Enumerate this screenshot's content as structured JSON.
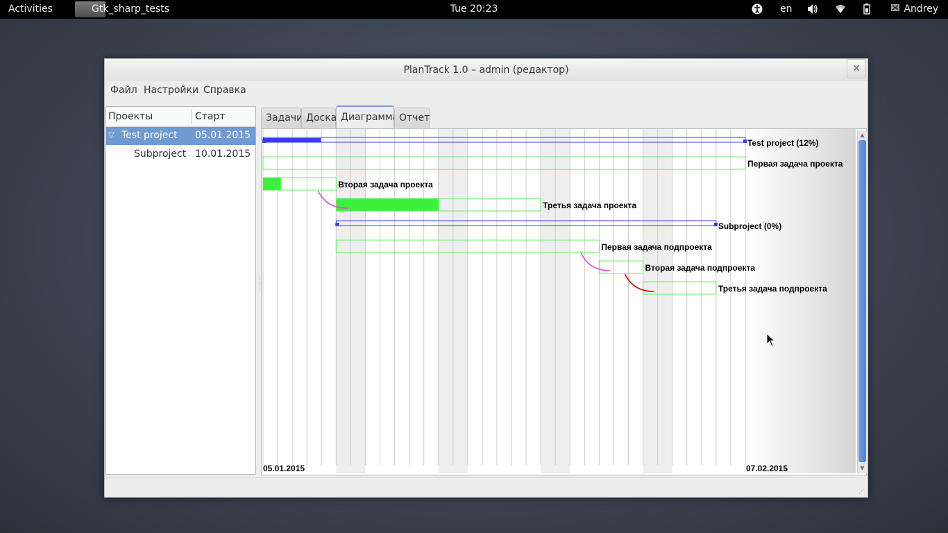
{
  "topbar": {
    "activities": "Activities",
    "app_name": "Gtk_sharp_tests",
    "clock": "Tue 20:23",
    "lang": "en",
    "user": "Andrey",
    "icons": [
      "accessibility-icon",
      "volume-icon",
      "wifi-icon",
      "battery-icon",
      "user-icon"
    ]
  },
  "window": {
    "title": "PlanTrack 1.0 – admin (редактор)",
    "close": "✕",
    "menu": {
      "file": "Файл",
      "settings": "Настройки",
      "help": "Справка"
    },
    "tree": {
      "col_projects": "Проекты",
      "col_start": "Старт",
      "rows": [
        {
          "name": "Test project",
          "start": "05.01.2015",
          "expanded": true,
          "selected": true
        },
        {
          "name": "Subproject",
          "start": "10.01.2015"
        }
      ]
    },
    "tabs": [
      "Задачи",
      "Доска",
      "Диаграмма",
      "Отчет"
    ],
    "active_tab": "Диаграмма"
  },
  "gantt": {
    "start_date": "05.01.2015",
    "end_date": "07.02.2015",
    "total_days": 34,
    "weekend_days": [
      5,
      6,
      12,
      13,
      19,
      20,
      26,
      27
    ],
    "colors": {
      "group": "#3a3aff",
      "task_border": "#5ef05e",
      "task_fill": "#3cf03c",
      "link_a": "#ee44ee",
      "link_b": "#dd0000",
      "weekend": "#eeeeee",
      "grid": "#cccccc"
    },
    "rows": [
      {
        "label": "Test project (12%)",
        "kind": "group",
        "start": 0,
        "end": 33,
        "progress": 0.12
      },
      {
        "label": "Первая задача проекта",
        "kind": "task",
        "start": 0,
        "end": 33,
        "progress": 0
      },
      {
        "label": "Вторая задача проекта",
        "kind": "task",
        "start": 0,
        "end": 5,
        "progress": 0.24
      },
      {
        "label": "Третья задача проекта",
        "kind": "task",
        "start": 5,
        "end": 19,
        "progress": 0.5
      },
      {
        "label": "Subproject (0%)",
        "kind": "group",
        "start": 5,
        "end": 31,
        "progress": 0
      },
      {
        "label": "Первая задача подпроекта",
        "kind": "task",
        "start": 5,
        "end": 23,
        "progress": 0
      },
      {
        "label": "Вторая задача подпроекта",
        "kind": "task",
        "start": 23,
        "end": 26,
        "progress": 0
      },
      {
        "label": "Третья задача подпроекта",
        "kind": "task",
        "start": 26,
        "end": 31,
        "progress": 0
      }
    ]
  }
}
